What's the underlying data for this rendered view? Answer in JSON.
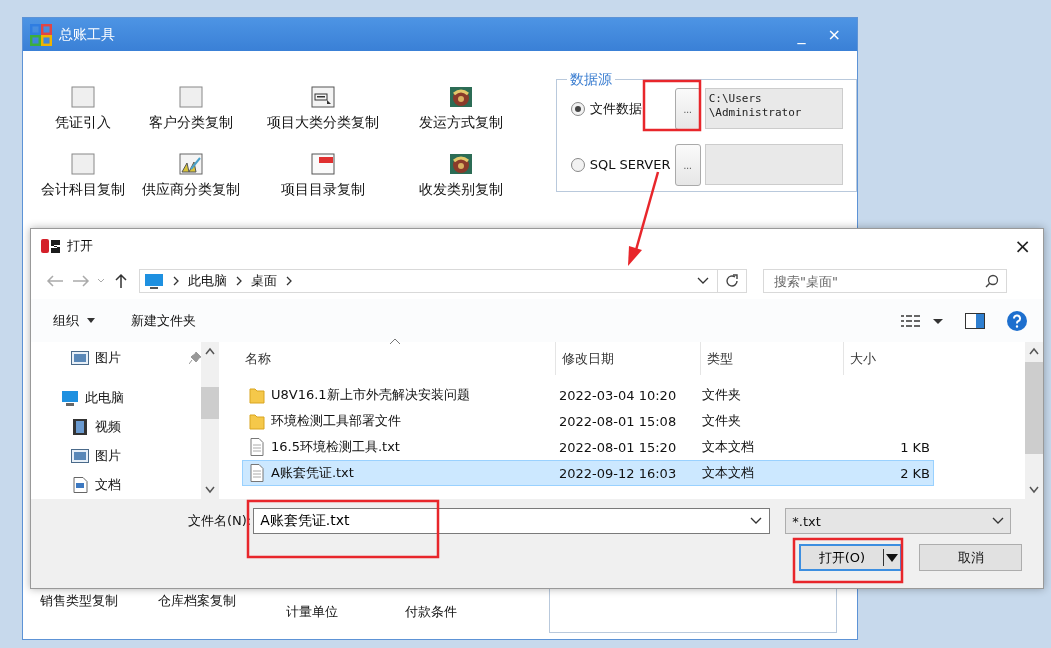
{
  "desktop_window": {
    "title": "总账工具",
    "minimize": "_",
    "close": "×",
    "tools": [
      {
        "label": "凭证引入",
        "kind": "blank"
      },
      {
        "label": "客户分类复制",
        "kind": "blank"
      },
      {
        "label": "项目大类分类复制",
        "kind": "form"
      },
      {
        "label": "发运方式复制",
        "kind": "image"
      },
      {
        "label": "会计科目复制",
        "kind": "blank"
      },
      {
        "label": "供应商分类复制",
        "kind": "chart"
      },
      {
        "label": "项目目录复制",
        "kind": "menu"
      },
      {
        "label": "收发类别复制",
        "kind": "image"
      }
    ],
    "data_source": {
      "legend": "数据源",
      "options": [
        {
          "label": "文件数据",
          "selected": true,
          "browse": "...",
          "path": "C:\\Users\n\\Administrator"
        },
        {
          "label": "SQL SERVER",
          "selected": false,
          "browse": "..."
        }
      ]
    },
    "lower_tools": [
      "销售类型复制",
      "仓库档案复制",
      "计量单位",
      "付款条件"
    ]
  },
  "open_dialog": {
    "title": "打开",
    "close": "×",
    "breadcrumb": [
      "此电脑",
      "桌面"
    ],
    "search_placeholder": "搜索\"桌面\"",
    "toolbar": [
      {
        "label": "组织",
        "menu": true
      },
      {
        "label": "新建文件夹",
        "menu": false
      }
    ],
    "nav": [
      {
        "label": "图片",
        "kind": "pictures",
        "pinned": true
      },
      {
        "label": "此电脑",
        "kind": "pc",
        "pinned": false,
        "children": [
          {
            "label": "视频",
            "kind": "videos",
            "pinned": false
          },
          {
            "label": "图片",
            "kind": "pictures",
            "pinned": false
          },
          {
            "label": "文档",
            "kind": "documents",
            "pinned": false
          }
        ]
      }
    ],
    "columns": [
      "名称",
      "修改日期",
      "类型",
      "大小"
    ],
    "files": [
      {
        "name": "U8V16.1新上市外壳解决安装问题",
        "date": "2022-03-04 10:20",
        "type": "文件夹",
        "kind": "folder",
        "selected": false
      },
      {
        "name": "环境检测工具部署文件",
        "date": "2022-08-01 15:08",
        "type": "文件夹",
        "kind": "folder",
        "selected": false
      },
      {
        "name": "16.5环境检测工具.txt",
        "date": "2022-08-01 15:20",
        "type": "文本文档",
        "size": "1 KB",
        "kind": "text",
        "selected": false
      },
      {
        "name": "A账套凭证.txt",
        "date": "2022-09-12 16:03",
        "type": "文本文档",
        "size": "2 KB",
        "kind": "text",
        "selected": true
      }
    ],
    "filename_label": "文件名(N):",
    "filename": "A账套凭证.txt",
    "filter": "*.txt",
    "open_button": "打开(O)",
    "cancel_button": "取消"
  }
}
